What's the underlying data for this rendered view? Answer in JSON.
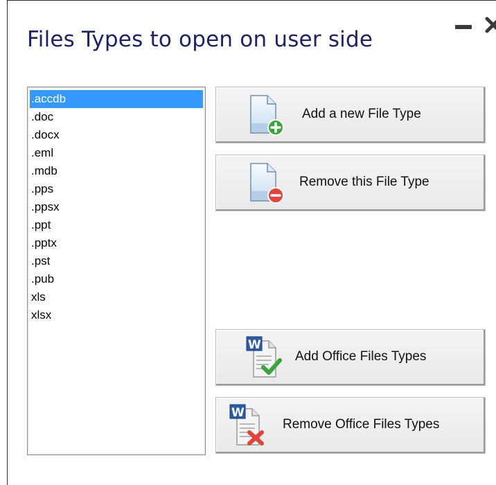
{
  "dialog": {
    "title": "Files Types to open on user side"
  },
  "window_controls": {
    "minimize_icon": "minimize-icon",
    "close_icon": "close-icon"
  },
  "file_types": {
    "items": [
      ".accdb",
      ".doc",
      ".docx",
      ".eml",
      ".mdb",
      ".pps",
      ".ppsx",
      ".ppt",
      ".pptx",
      ".pst",
      ".pub",
      "xls",
      "xlsx"
    ],
    "selected_index": 0
  },
  "buttons": {
    "add_file_type": "Add a new File Type",
    "remove_file_type": "Remove this File Type",
    "add_office_types": "Add Office Files Types",
    "remove_office_types": "Remove Office Files Types"
  },
  "colors": {
    "title": "#1f1f6e",
    "selection": "#3399ff",
    "add_badge": "#3aa53a",
    "remove_badge": "#e0443a"
  }
}
